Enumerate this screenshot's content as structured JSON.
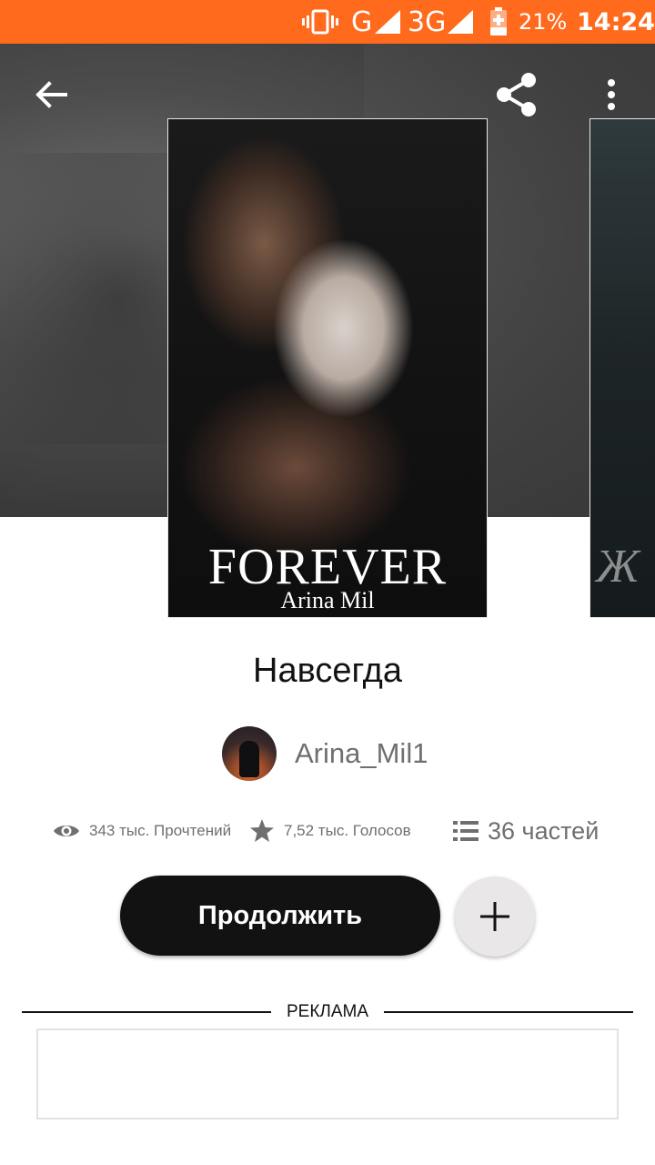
{
  "status_bar": {
    "network_g": "G",
    "network_3g": "3G",
    "battery_percent": "21%",
    "time": "14:24",
    "icons": [
      "vibrate-icon",
      "signal-icon",
      "signal-icon",
      "battery-charging-icon"
    ]
  },
  "toolbar": {
    "icons": [
      "back-arrow-icon",
      "share-icon",
      "more-vert-icon"
    ]
  },
  "cover": {
    "title": "FOREVER",
    "author": "Arina Mil"
  },
  "story": {
    "title": "Навсегда",
    "author_name": "Arina_Mil1"
  },
  "stats": {
    "reads": "343 тыс. Прочтений",
    "votes": "7,52 тыс. Голосов",
    "parts": "36 частей",
    "icons": [
      "eye-icon",
      "star-icon",
      "list-icon"
    ]
  },
  "actions": {
    "continue_label": "Продолжить",
    "add_icon": "plus-icon"
  },
  "ad": {
    "label": "РЕКЛАМА"
  },
  "colors": {
    "status_bar": "#ff6a1d",
    "primary_button": "#121212",
    "add_button": "#e9e7e8",
    "muted_text": "#6f6f6f"
  }
}
